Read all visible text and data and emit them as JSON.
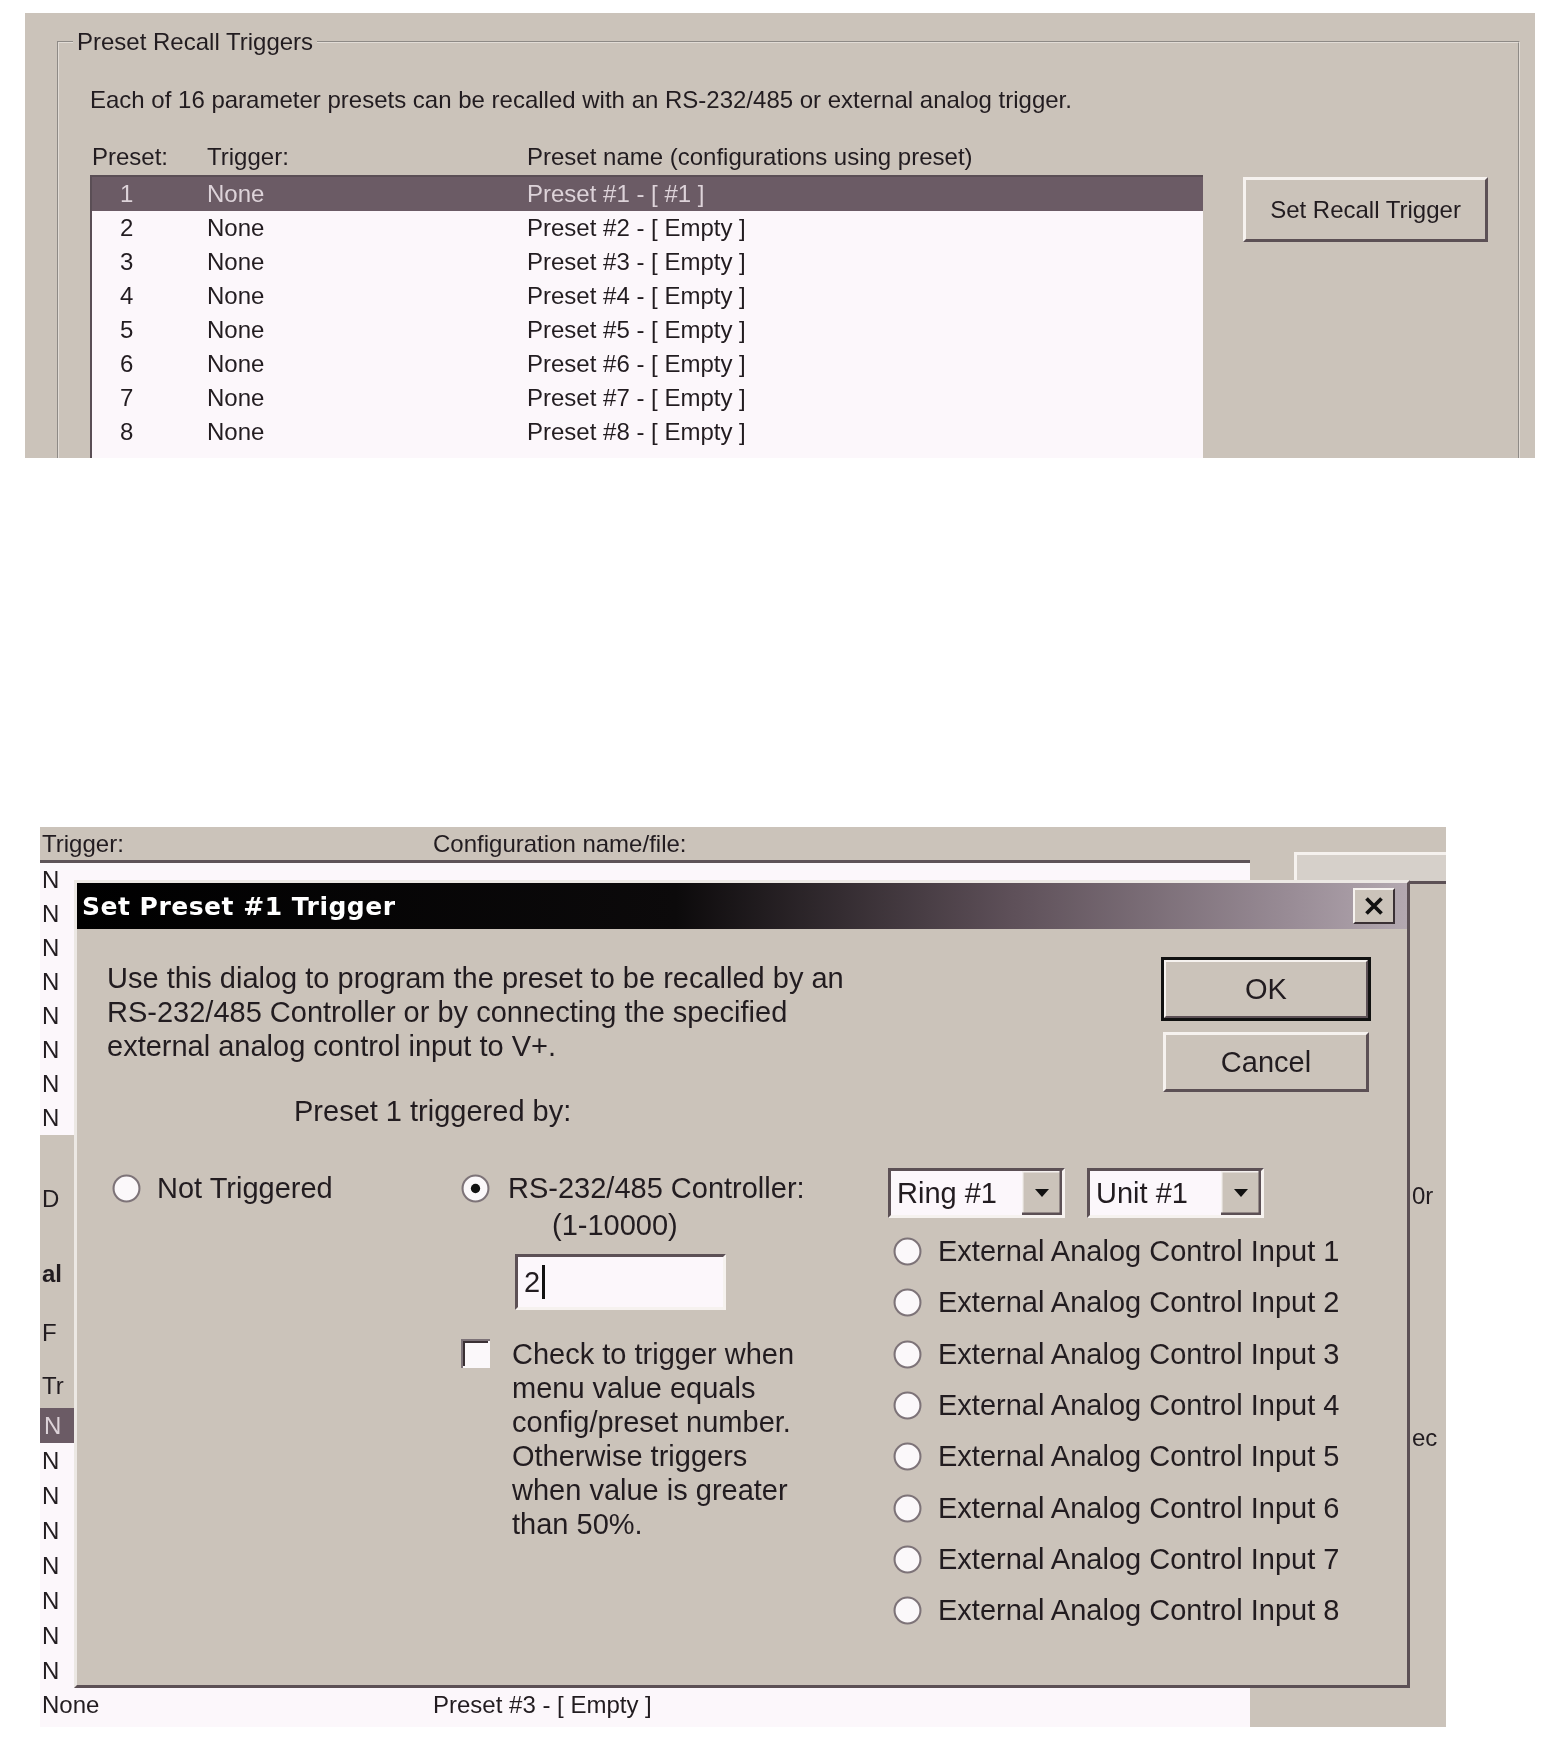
{
  "preset_recall": {
    "group_title": "Preset Recall Triggers",
    "description": "Each of 16 parameter presets can be recalled with an RS-232/485 or external analog trigger.",
    "columns": [
      "Preset:",
      "Trigger:",
      "Preset name (configurations using preset)"
    ],
    "rows": [
      {
        "preset": "1",
        "trigger": "None",
        "name": "Preset #1 - [ #1 ]",
        "selected": true
      },
      {
        "preset": "2",
        "trigger": "None",
        "name": "Preset #2 - [ Empty ]",
        "selected": false
      },
      {
        "preset": "3",
        "trigger": "None",
        "name": "Preset #3 - [ Empty ]",
        "selected": false
      },
      {
        "preset": "4",
        "trigger": "None",
        "name": "Preset #4 - [ Empty ]",
        "selected": false
      },
      {
        "preset": "5",
        "trigger": "None",
        "name": "Preset #5 - [ Empty ]",
        "selected": false
      },
      {
        "preset": "6",
        "trigger": "None",
        "name": "Preset #6 - [ Empty ]",
        "selected": false
      },
      {
        "preset": "7",
        "trigger": "None",
        "name": "Preset #7 - [ Empty ]",
        "selected": false
      },
      {
        "preset": "8",
        "trigger": "None",
        "name": "Preset #8 - [ Empty ]",
        "selected": false
      }
    ],
    "button": "Set Recall Trigger"
  },
  "background_window": {
    "columns": [
      "Trigger:",
      "Configuration name/file:"
    ],
    "upper_rows": [
      {
        "trigger": "N"
      },
      {
        "trigger": "N"
      },
      {
        "trigger": "N"
      },
      {
        "trigger": "N"
      },
      {
        "trigger": "N"
      },
      {
        "trigger": "N"
      },
      {
        "trigger": "N"
      },
      {
        "trigger": "N"
      }
    ],
    "left_labels": [
      "D",
      "al",
      "F",
      "Tr"
    ],
    "lower_rows": [
      {
        "trigger": "N",
        "selected": true
      },
      {
        "trigger": "N",
        "selected": false
      },
      {
        "trigger": "N",
        "selected": false
      },
      {
        "trigger": "N",
        "selected": false
      },
      {
        "trigger": "N",
        "selected": false
      },
      {
        "trigger": "N",
        "selected": false
      },
      {
        "trigger": "N",
        "selected": false
      },
      {
        "trigger": "N",
        "selected": false
      },
      {
        "trigger": "None",
        "name": "Preset #3 - [ Empty ]",
        "selected": false
      }
    ],
    "right_labels": [
      "0r",
      "ec"
    ]
  },
  "dialog": {
    "title": "Set Preset #1 Trigger",
    "description": "Use this dialog to program the preset to be recalled by an RS-232/485 Controller or by connecting the specified external analog control input to V+.",
    "buttons": [
      {
        "label": "OK",
        "default": true
      },
      {
        "label": "Cancel",
        "default": false
      }
    ],
    "triggered_by_label": "Preset 1 triggered by:",
    "not_triggered": {
      "label": "Not Triggered",
      "selected": false
    },
    "controller": {
      "label": "RS-232/485 Controller:",
      "range": "(1-10000)",
      "value": "2",
      "selected": true
    },
    "checkbox": {
      "label": "Check to trigger when menu value equals config/preset number. Otherwise triggers when value is greater than 50%.",
      "checked": false
    },
    "ring_select": {
      "value": "Ring #1"
    },
    "unit_select": {
      "value": "Unit #1"
    },
    "analog_inputs": [
      {
        "label": "External Analog Control Input 1",
        "selected": false
      },
      {
        "label": "External Analog Control Input 2",
        "selected": false
      },
      {
        "label": "External Analog Control Input 3",
        "selected": false
      },
      {
        "label": "External Analog Control Input 4",
        "selected": false
      },
      {
        "label": "External Analog Control Input 5",
        "selected": false
      },
      {
        "label": "External Analog Control Input 6",
        "selected": false
      },
      {
        "label": "External Analog Control Input 7",
        "selected": false
      },
      {
        "label": "External Analog Control Input 8",
        "selected": false
      }
    ]
  }
}
